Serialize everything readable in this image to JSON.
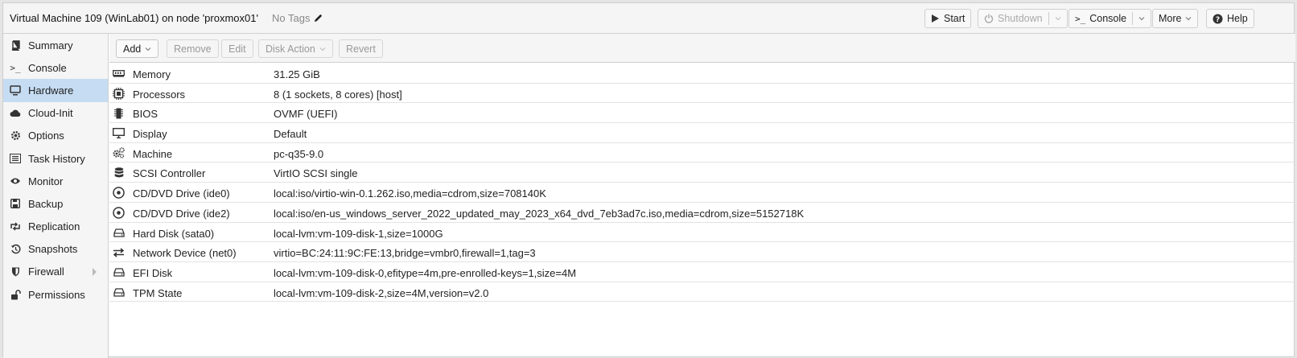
{
  "header": {
    "title": "Virtual Machine 109 (WinLab01) on node 'proxmox01'",
    "tags": "No Tags",
    "buttons": {
      "start": "Start",
      "shutdown": "Shutdown",
      "console": "Console",
      "more": "More",
      "help": "Help"
    }
  },
  "sidebar": {
    "items": [
      {
        "label": "Summary",
        "icon": "book-icon"
      },
      {
        "label": "Console",
        "icon": "terminal-icon"
      },
      {
        "label": "Hardware",
        "icon": "monitor-icon",
        "active": true
      },
      {
        "label": "Cloud-Init",
        "icon": "cloud-icon"
      },
      {
        "label": "Options",
        "icon": "gear-icon"
      },
      {
        "label": "Task History",
        "icon": "list-icon"
      },
      {
        "label": "Monitor",
        "icon": "eye-icon"
      },
      {
        "label": "Backup",
        "icon": "floppy-icon"
      },
      {
        "label": "Replication",
        "icon": "retweet-icon"
      },
      {
        "label": "Snapshots",
        "icon": "history-icon"
      },
      {
        "label": "Firewall",
        "icon": "shield-icon"
      },
      {
        "label": "Permissions",
        "icon": "unlock-icon"
      }
    ]
  },
  "toolbar": {
    "add": "Add",
    "remove": "Remove",
    "edit": "Edit",
    "disk_action": "Disk Action",
    "revert": "Revert"
  },
  "hardware": [
    {
      "name": "Memory",
      "value": "31.25 GiB",
      "icon": "memory-icon"
    },
    {
      "name": "Processors",
      "value": "8 (1 sockets, 8 cores) [host]",
      "icon": "cpu-icon"
    },
    {
      "name": "BIOS",
      "value": "OVMF (UEFI)",
      "icon": "microchip-icon"
    },
    {
      "name": "Display",
      "value": "Default",
      "icon": "desktop-icon"
    },
    {
      "name": "Machine",
      "value": "pc-q35-9.0",
      "icon": "cogs-icon"
    },
    {
      "name": "SCSI Controller",
      "value": "VirtIO SCSI single",
      "icon": "database-icon"
    },
    {
      "name": "CD/DVD Drive (ide0)",
      "value": "local:iso/virtio-win-0.1.262.iso,media=cdrom,size=708140K",
      "icon": "cdrom-icon"
    },
    {
      "name": "CD/DVD Drive (ide2)",
      "value": "local:iso/en-us_windows_server_2022_updated_may_2023_x64_dvd_7eb3ad7c.iso,media=cdrom,size=5152718K",
      "icon": "cdrom-icon"
    },
    {
      "name": "Hard Disk (sata0)",
      "value": "local-lvm:vm-109-disk-1,size=1000G",
      "icon": "hdd-icon"
    },
    {
      "name": "Network Device (net0)",
      "value": "virtio=BC:24:11:9C:FE:13,bridge=vmbr0,firewall=1,tag=3",
      "icon": "exchange-icon"
    },
    {
      "name": "EFI Disk",
      "value": "local-lvm:vm-109-disk-0,efitype=4m,pre-enrolled-keys=1,size=4M",
      "icon": "hdd-icon"
    },
    {
      "name": "TPM State",
      "value": "local-lvm:vm-109-disk-2,size=4M,version=v2.0",
      "icon": "hdd-icon"
    }
  ]
}
